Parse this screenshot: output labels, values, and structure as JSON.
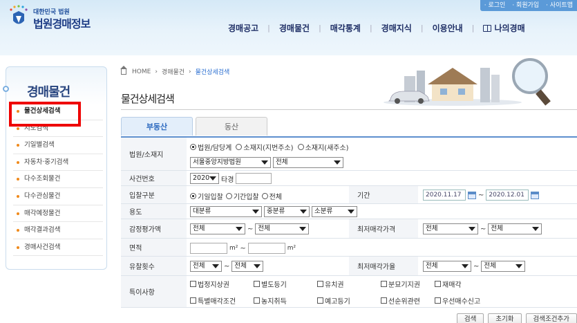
{
  "header": {
    "logo_small": "대한민국 법원",
    "logo_big": "법원경매정보",
    "util_links": [
      "· 로그인",
      "· 회원가입",
      "· 사이트맵"
    ],
    "gnb": [
      "경매공고",
      "경매물건",
      "매각통계",
      "경매지식",
      "이용안내",
      "나의경매"
    ]
  },
  "sidebar": {
    "title": "경매물건",
    "items": [
      "물건상세검색",
      "지도검색",
      "기일별검색",
      "자동차·중기검색",
      "다수조회물건",
      "다수관심물건",
      "매각예정물건",
      "매각결과검색",
      "경매사건검색"
    ]
  },
  "breadcrumb": {
    "home": "HOME",
    "level1": "경매물건",
    "current": "물건상세검색"
  },
  "page_title": "물건상세검색",
  "tabs": [
    "부동산",
    "동산"
  ],
  "form": {
    "court_label": "법원/소재지",
    "court_radios": [
      "법원/담당계",
      "소재지(지번주소)",
      "소재지(새주소)"
    ],
    "court_select": "서울중앙지방법원",
    "court_sub_select": "전체",
    "case_label": "사건번호",
    "case_year": "2020",
    "case_suffix": "타경",
    "bid_label": "입찰구분",
    "bid_radios": [
      "기일입찰",
      "기간입찰",
      "전체"
    ],
    "period_label": "기간",
    "date_from": "2020.11.17",
    "date_to": "2020.12.01",
    "usage_label": "용도",
    "usage_selects": [
      "대분류",
      "중분류",
      "소분류"
    ],
    "appraisal_label": "감정평가액",
    "appraisal_from": "전체",
    "appraisal_to": "전체",
    "min_price_label": "최저매각가격",
    "min_price_from": "전체",
    "min_price_to": "전체",
    "area_label": "면적",
    "area_unit": "m²",
    "fail_label": "유찰횟수",
    "fail_from": "전체",
    "fail_to": "전체",
    "min_rate_label": "최저매각가율",
    "min_rate_from": "전체",
    "min_rate_to": "전체",
    "special_label": "특이사항",
    "special_row1": [
      "법정지상권",
      "별도등기",
      "유치권",
      "분묘기지권",
      "재매각"
    ],
    "special_row2": [
      "특별매각조건",
      "농지취득",
      "예고등기",
      "선순위관련",
      "우선매수신고"
    ],
    "tilde": "~"
  },
  "buttons": [
    "검색",
    "초기화",
    "검색조건추가"
  ]
}
